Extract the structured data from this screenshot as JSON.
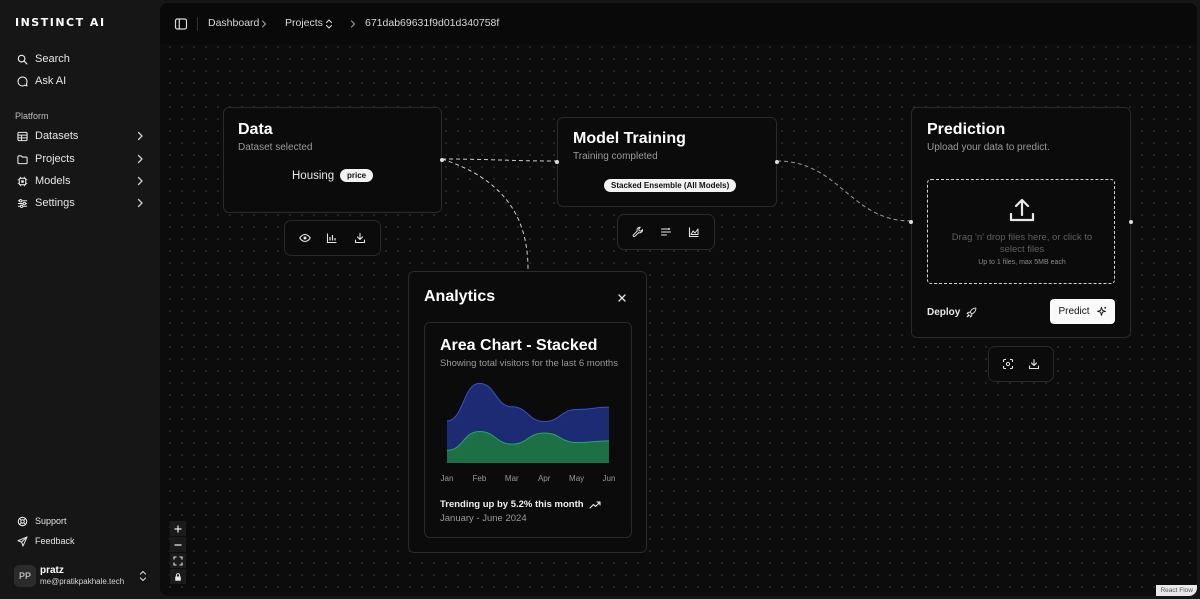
{
  "app": {
    "brand": "INSTINCT AI"
  },
  "sidebar": {
    "search_label": "Search",
    "ask_label": "Ask AI",
    "section_label": "Platform",
    "items": [
      {
        "label": "Datasets"
      },
      {
        "label": "Projects"
      },
      {
        "label": "Models"
      },
      {
        "label": "Settings"
      }
    ],
    "support_label": "Support",
    "feedback_label": "Feedback",
    "user": {
      "initials": "PP",
      "name": "pratz",
      "email": "me@pratikpakhale.tech"
    }
  },
  "breadcrumb": {
    "items": [
      "Dashboard",
      "Projects",
      "671dab69631f9d01d340758f"
    ]
  },
  "nodes": {
    "data": {
      "title": "Data",
      "subtitle": "Dataset selected",
      "dataset": "Housing",
      "target_badge": "price"
    },
    "training": {
      "title": "Model Training",
      "subtitle": "Training completed",
      "model_badge": "Stacked Ensemble (All Models)"
    },
    "prediction": {
      "title": "Prediction",
      "subtitle": "Upload your data to predict.",
      "drop_text": "Drag 'n' drop files here, or click to select files",
      "drop_limit": "Up to 1 files, max 5MB each",
      "deploy_label": "Deploy",
      "predict_label": "Predict"
    }
  },
  "analytics": {
    "title": "Analytics",
    "card_title": "Area Chart - Stacked",
    "card_subtitle": "Showing total visitors for the last 6 months",
    "trend_text": "Trending up by 5.2% this month",
    "date_range": "January - June 2024"
  },
  "chart_data": {
    "type": "area",
    "stacked": true,
    "categories": [
      "Jan",
      "Feb",
      "Mar",
      "Apr",
      "May",
      "Jun"
    ],
    "series": [
      {
        "values": [
          80,
          200,
          120,
          190,
          130,
          140
        ]
      },
      {
        "values": [
          186,
          305,
          237,
          73,
          209,
          214
        ]
      }
    ],
    "ylim": [
      0,
      520
    ],
    "colors": [
      "#1f7a4c",
      "#1e2f80"
    ],
    "line_colors": [
      "#2ea36a",
      "#3a52c2"
    ],
    "grid": false
  },
  "reactflow": {
    "attribution": "React Flow"
  }
}
